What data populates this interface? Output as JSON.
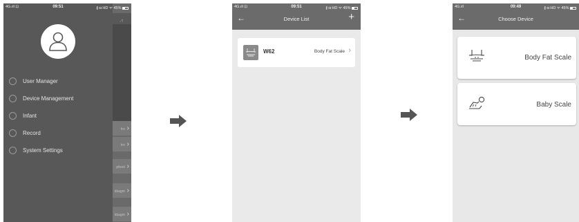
{
  "phone1": {
    "status": {
      "carrier": "4G.ıll ⊡",
      "time": "09:51",
      "icons": "∦ ◘ HD ᯤ 45%"
    },
    "menu": [
      {
        "label": "User Manager",
        "icon": "user-circle-icon"
      },
      {
        "label": "Device Management",
        "icon": "device-icon"
      },
      {
        "label": "Infant",
        "icon": "infant-icon"
      },
      {
        "label": "Record",
        "icon": "record-icon"
      },
      {
        "label": "System Settings",
        "icon": "settings-icon"
      }
    ],
    "peek_rows": [
      "tro",
      "tro",
      "pfeed",
      "kbagm",
      "kbagm"
    ]
  },
  "phone2": {
    "status": {
      "carrier": "4G.ıll ⊡",
      "time": "09:51",
      "icons": "∦ ◘ HD ᯤ 45%"
    },
    "title": "Device List",
    "back": "←",
    "add": "+",
    "device": {
      "name": "W62",
      "type": "Body Fat Scale"
    }
  },
  "phone3": {
    "status": {
      "carrier": "4G.ıll",
      "time": "09:49",
      "icons": "∦ ◘ HD ᯤ 45%"
    },
    "title": "Choose Device",
    "back": "←",
    "options": [
      {
        "label": "Body Fat Scale",
        "icon": "body-fat-scale-icon"
      },
      {
        "label": "Baby Scale",
        "icon": "baby-scale-icon"
      }
    ]
  },
  "colors": {
    "header": "#6b6b6b",
    "drawer": "#585858",
    "background": "#eaeaea",
    "arrow": "#555555"
  }
}
